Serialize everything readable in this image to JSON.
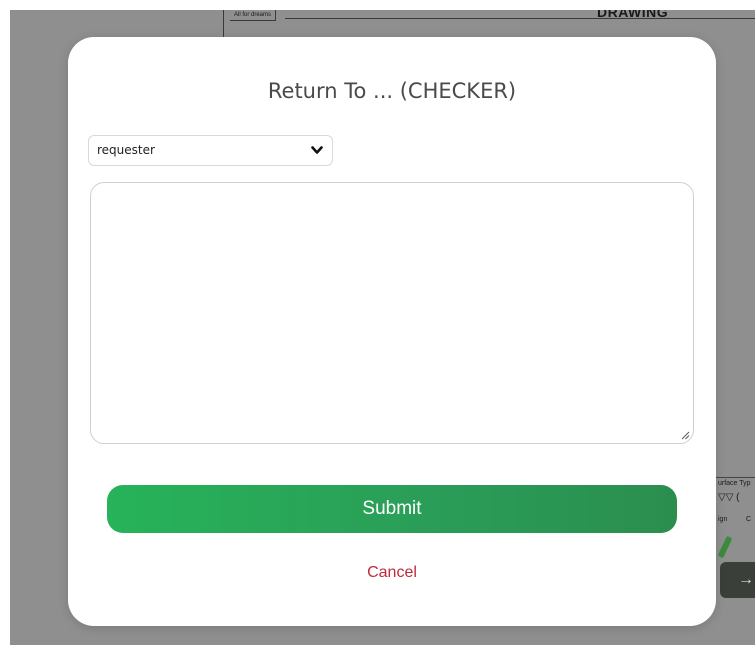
{
  "background": {
    "drawing_note": "All for dreams",
    "drawing_title": "DRAWING",
    "title_block": {
      "surface_type": "urface Typ",
      "symbol": "▽▽ (",
      "sign": "ign",
      "col": "C"
    },
    "arrow_icon": "arrow-right-icon"
  },
  "modal": {
    "title": "Return To ... (CHECKER)",
    "select": {
      "value": "requester",
      "icon": "chevron-down-icon"
    },
    "textarea": {
      "value": "",
      "placeholder": ""
    },
    "submit_label": "Submit",
    "cancel_label": "Cancel"
  },
  "colors": {
    "backdrop": "#8f8f8f",
    "submit_start": "#27b359",
    "submit_end": "#2b8e4f",
    "cancel": "#c2283a",
    "title": "#4a4a4a"
  }
}
